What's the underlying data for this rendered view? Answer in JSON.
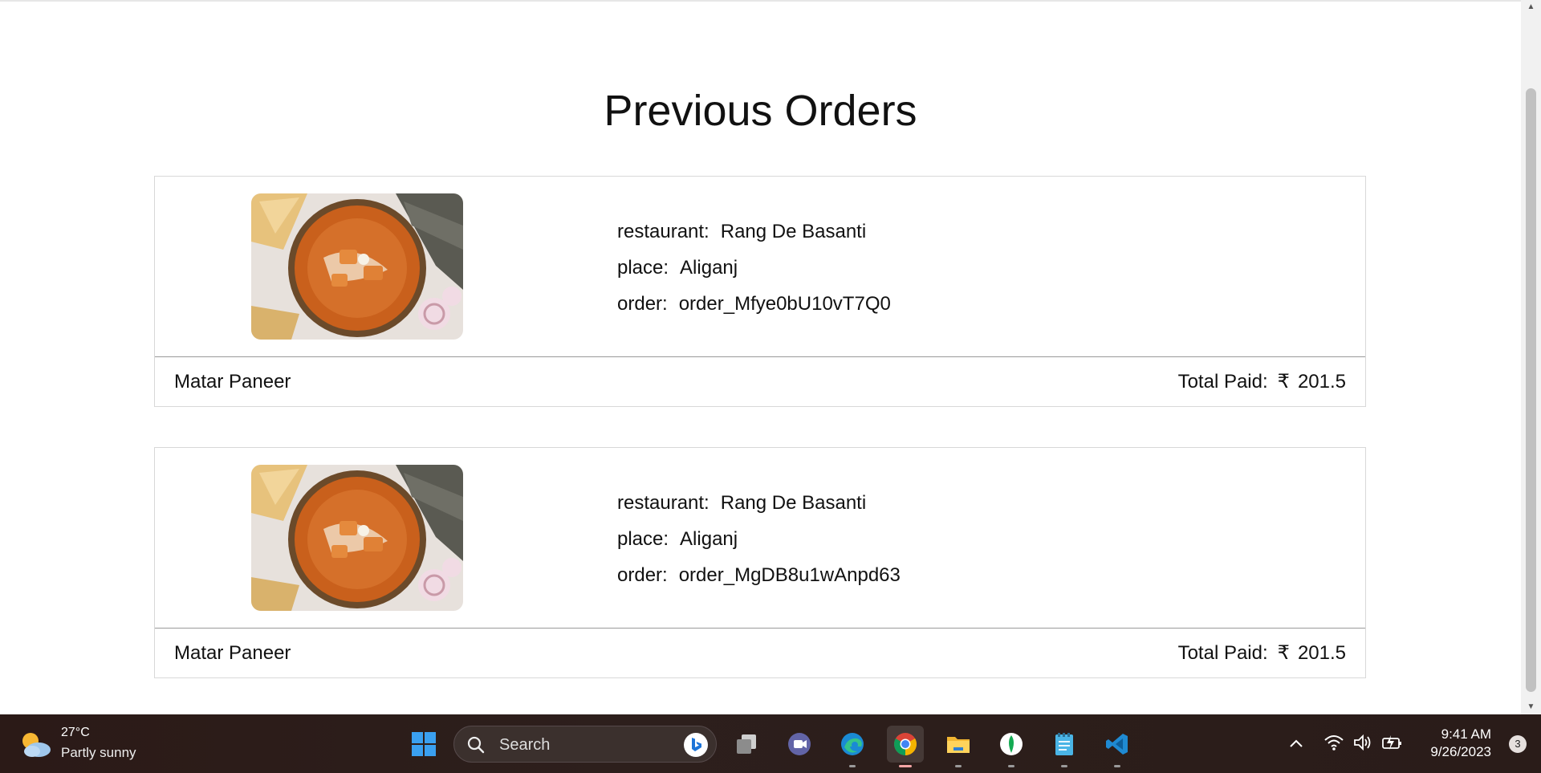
{
  "page": {
    "title": "Previous Orders"
  },
  "orders": [
    {
      "image_alt": "paneer curry dish",
      "restaurant_label": "restaurant:",
      "restaurant": "Rang De Basanti",
      "place_label": "place:",
      "place": "Aliganj",
      "order_label": "order:",
      "order_id": "order_Mfye0bU10vT7Q0",
      "dish": "Matar Paneer",
      "total_label": "Total Paid:",
      "currency": "₹",
      "total": "201.5"
    },
    {
      "image_alt": "paneer curry dish",
      "restaurant_label": "restaurant:",
      "restaurant": "Rang De Basanti",
      "place_label": "place:",
      "place": "Aliganj",
      "order_label": "order:",
      "order_id": "order_MgDB8u1wAnpd63",
      "dish": "Matar Paneer",
      "total_label": "Total Paid:",
      "currency": "₹",
      "total": "201.5"
    }
  ],
  "taskbar": {
    "weather": {
      "temp": "27°C",
      "desc": "Partly sunny",
      "icon": "partly-sunny-icon"
    },
    "search": {
      "placeholder": "Search"
    },
    "apps": [
      "windows-start-icon",
      "task-view-icon",
      "teams-chat-icon",
      "edge-icon",
      "chrome-icon",
      "file-explorer-icon",
      "mongodb-compass-icon",
      "notepad-icon",
      "vscode-icon"
    ],
    "clock": {
      "time": "9:41 AM",
      "date": "9/26/2023"
    },
    "notifications": "3"
  },
  "colors": {
    "accent_chrome_underline": "#f6a5a5",
    "taskbar_bg": "#2b1a17"
  }
}
